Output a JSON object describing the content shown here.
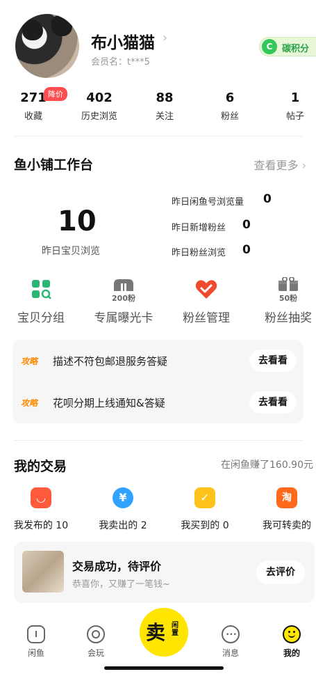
{
  "profile": {
    "name": "布小猫猫",
    "member_label": "会员名：t***5",
    "carbon_icon": "C",
    "carbon_label": "碳积分"
  },
  "stats": [
    {
      "value": "271",
      "label": "收藏"
    },
    {
      "value": "402",
      "label": "历史浏览"
    },
    {
      "value": "88",
      "label": "关注"
    },
    {
      "value": "6",
      "label": "粉丝"
    },
    {
      "value": "1",
      "label": "帖子"
    }
  ],
  "stats_badge": "降价",
  "workbench": {
    "title": "鱼小铺工作台",
    "see_more": "查看更多",
    "views_value": "10",
    "views_label": "昨日宝贝浏览",
    "metrics": [
      {
        "label": "昨日闲鱼号浏览量",
        "value": "0"
      },
      {
        "label": "昨日新增粉丝",
        "value": "0"
      },
      {
        "label": "昨日粉丝浏览",
        "value": "0"
      }
    ],
    "tools": [
      {
        "label": "宝贝分组",
        "icon": "grid-search-icon",
        "tag": ""
      },
      {
        "label": "专属曝光卡",
        "icon": "exposure-card-icon",
        "tag": "200粉"
      },
      {
        "label": "粉丝管理",
        "icon": "heart-check-icon",
        "tag": ""
      },
      {
        "label": "粉丝抽奖",
        "icon": "gift-icon",
        "tag": "50粉"
      }
    ],
    "tips": [
      {
        "tag": "攻略",
        "text": "描述不符包邮退服务答疑",
        "button": "去看看"
      },
      {
        "tag": "攻略",
        "text": "花呗分期上线通知&答疑",
        "button": "去看看"
      }
    ]
  },
  "trades": {
    "title": "我的交易",
    "earned": "在闲鱼赚了160.90元",
    "items": [
      {
        "label": "我发布的 10",
        "icon": "bag-icon",
        "glyph": "◡",
        "color": "#ff5a3c"
      },
      {
        "label": "我卖出的 2",
        "icon": "yen-icon",
        "glyph": "¥",
        "color": "#2fa3ff"
      },
      {
        "label": "我买到的 0",
        "icon": "checklist-icon",
        "glyph": "✓",
        "color": "#ffc21a"
      },
      {
        "label": "我可转卖的",
        "icon": "taobao-icon",
        "glyph": "淘",
        "color": "#ff6a1a"
      }
    ],
    "review": {
      "title": "交易成功，待评价",
      "subtitle": "恭喜你，又赚了一笔钱~",
      "button": "去评价"
    }
  },
  "tabbar": {
    "tabs": [
      {
        "label": "闲鱼",
        "icon": "home-icon"
      },
      {
        "label": "会玩",
        "icon": "play-icon"
      },
      {
        "label": "消息",
        "icon": "message-icon"
      },
      {
        "label": "我的",
        "icon": "me-icon"
      }
    ],
    "sell_main": "卖",
    "sell_sub": "闲置"
  }
}
